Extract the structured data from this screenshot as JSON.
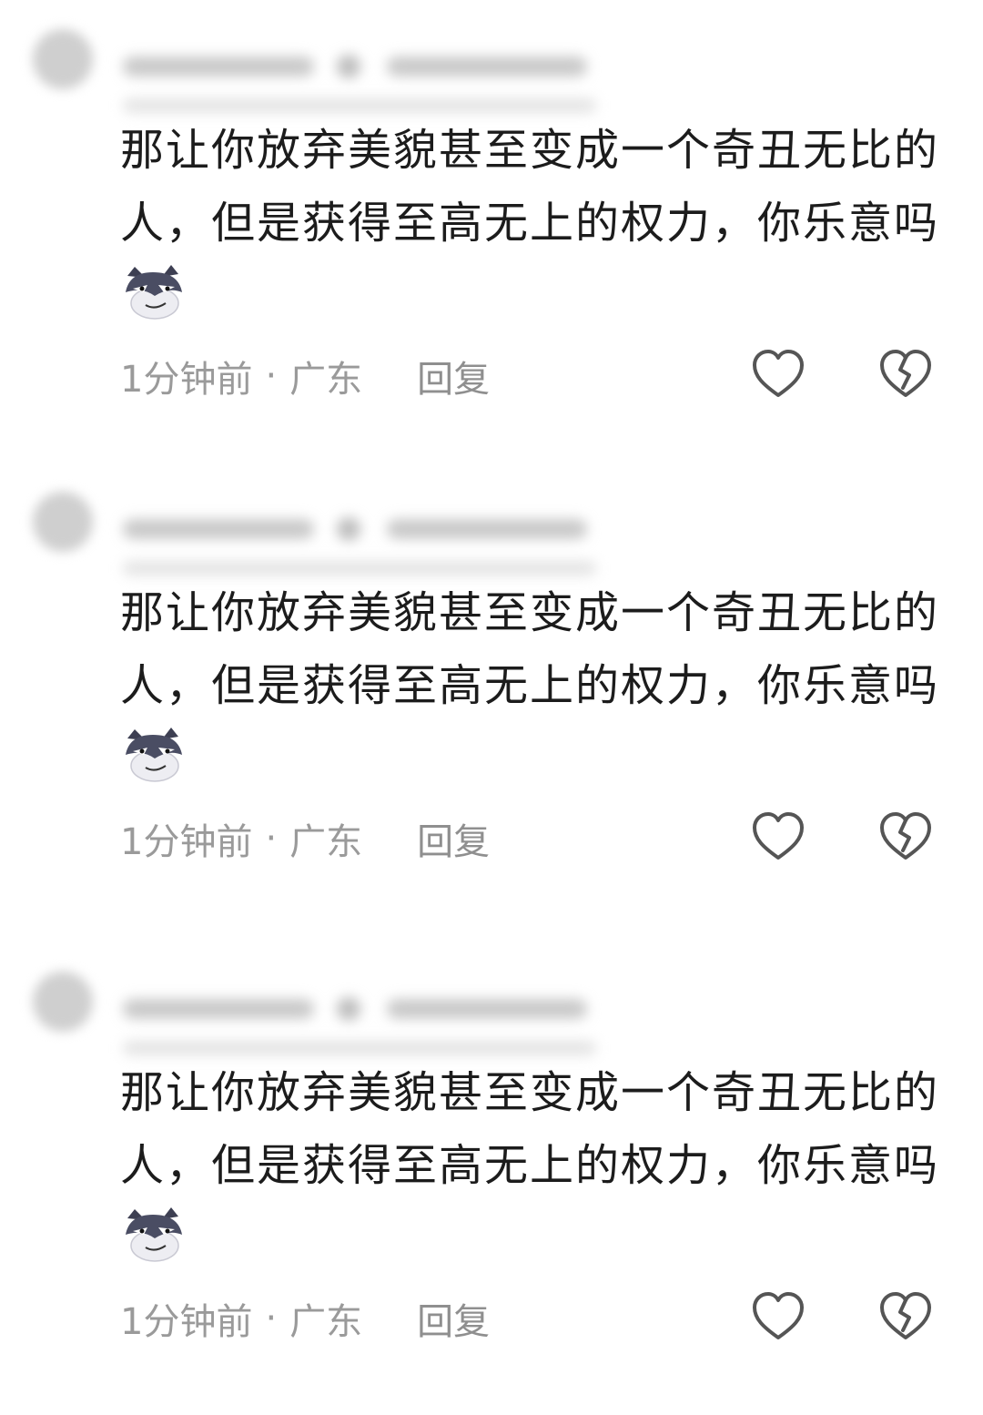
{
  "comments": [
    {
      "text": "那让你放弃美貌甚至变成一个奇丑无比的人，但是获得至高无上的权力，你乐意吗",
      "emoji": "raccoon-smirk-emoji",
      "time": "1分钟前",
      "separator": "·",
      "location": "广东",
      "reply_label": "回复",
      "like_icon": "heart-icon",
      "dislike_icon": "broken-heart-icon"
    },
    {
      "text": "那让你放弃美貌甚至变成一个奇丑无比的人，但是获得至高无上的权力，你乐意吗",
      "emoji": "raccoon-smirk-emoji",
      "time": "1分钟前",
      "separator": "·",
      "location": "广东",
      "reply_label": "回复",
      "like_icon": "heart-icon",
      "dislike_icon": "broken-heart-icon"
    },
    {
      "text": "那让你放弃美貌甚至变成一个奇丑无比的人，但是获得至高无上的权力，你乐意吗",
      "emoji": "raccoon-smirk-emoji",
      "time": "1分钟前",
      "separator": "·",
      "location": "广东",
      "reply_label": "回复",
      "like_icon": "heart-icon",
      "dislike_icon": "broken-heart-icon"
    }
  ],
  "colors": {
    "text": "#1c1c1c",
    "meta": "#9a9a9a",
    "icon": "#555555"
  }
}
